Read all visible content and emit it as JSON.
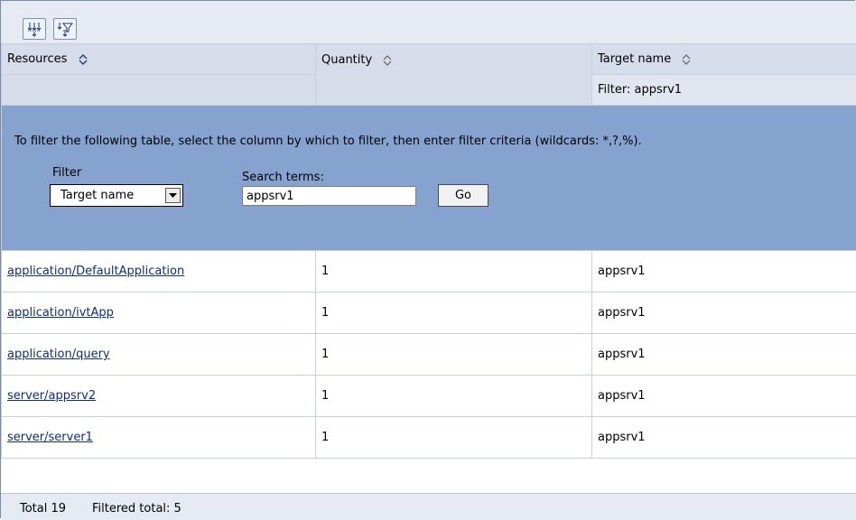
{
  "toolbar": {
    "buttons": [
      {
        "icon": "select-all-icon"
      },
      {
        "icon": "filter-icon"
      }
    ]
  },
  "table": {
    "columns": [
      {
        "label": "Resources",
        "sub": ""
      },
      {
        "label": "Quantity",
        "sub": ""
      },
      {
        "label": "Target name",
        "sub": "Filter: appsrv1"
      }
    ],
    "rows": [
      {
        "resource": "application/DefaultApplication",
        "quantity": "1",
        "target": "appsrv1"
      },
      {
        "resource": "application/ivtApp",
        "quantity": "1",
        "target": "appsrv1"
      },
      {
        "resource": "application/query",
        "quantity": "1",
        "target": "appsrv1"
      },
      {
        "resource": "server/appsrv2",
        "quantity": "1",
        "target": "appsrv1"
      },
      {
        "resource": "server/server1",
        "quantity": "1",
        "target": "appsrv1"
      }
    ]
  },
  "filter": {
    "instructions": "To filter the following table, select the column by which to filter, then enter filter criteria (wildcards: *,?,%).",
    "filter_label": "Filter",
    "selected_column": "Target name",
    "search_label": "Search terms:",
    "search_value": "appsrv1",
    "go_label": "Go"
  },
  "footer": {
    "total": "Total 19",
    "filtered": "Filtered total: 5"
  },
  "colors": {
    "header_bg": "#d6dcea",
    "filter_bg": "#86a3d0",
    "link": "#0d2b8c"
  }
}
